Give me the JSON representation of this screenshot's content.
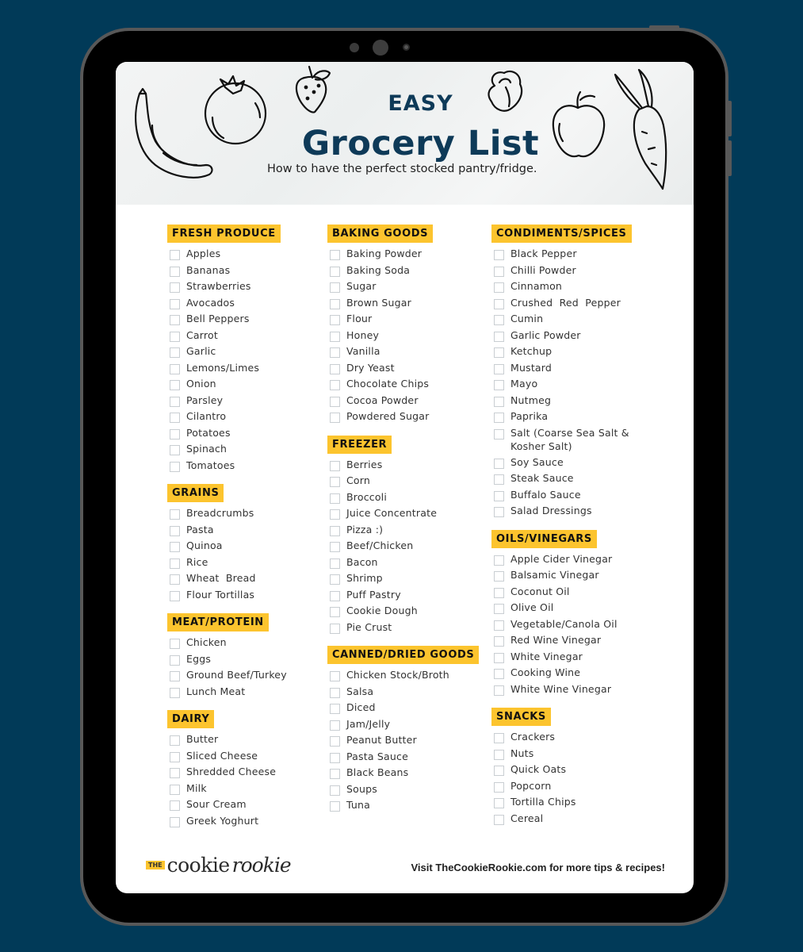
{
  "header": {
    "title_small": "EASY",
    "title_main": "Grocery List",
    "subtitle": "How to have the perfect stocked pantry/fridge.",
    "doodles": [
      "banana-icon",
      "tomato-icon",
      "strawberry-icon",
      "pepper-icon",
      "apple-icon",
      "carrot-icon"
    ]
  },
  "colors": {
    "background": "#013a58",
    "title": "#0e3a58",
    "badge": "#fcc42e"
  },
  "columns": [
    {
      "sections": [
        {
          "title": "FRESH PRODUCE",
          "items": [
            "Apples",
            "Bananas",
            "Strawberries",
            "Avocados",
            "Bell Peppers",
            "Carrot",
            "Garlic",
            "Lemons/Limes",
            "Onion",
            "Parsley",
            "Cilantro",
            "Potatoes",
            "Spinach",
            "Tomatoes"
          ]
        },
        {
          "title": "GRAINS",
          "items": [
            "Breadcrumbs",
            "Pasta",
            "Quinoa",
            "Rice",
            "Wheat  Bread",
            "Flour Tortillas"
          ]
        },
        {
          "title": "MEAT/PROTEIN",
          "items": [
            "Chicken",
            "Eggs",
            "Ground Beef/Turkey",
            "Lunch Meat"
          ]
        },
        {
          "title": "DAIRY",
          "items": [
            "Butter",
            "Sliced Cheese",
            "Shredded Cheese",
            "Milk",
            "Sour Cream",
            "Greek Yoghurt"
          ]
        }
      ]
    },
    {
      "sections": [
        {
          "title": "BAKING GOODS",
          "items": [
            "Baking Powder",
            "Baking Soda",
            "Sugar",
            "Brown Sugar",
            "Flour",
            "Honey",
            "Vanilla",
            "Dry Yeast",
            "Chocolate Chips",
            "Cocoa Powder",
            "Powdered Sugar"
          ]
        },
        {
          "title": "FREEZER",
          "items": [
            "Berries",
            "Corn",
            "Broccoli",
            "Juice Concentrate",
            "Pizza :)",
            "Beef/Chicken",
            "Bacon",
            "Shrimp",
            "Puff Pastry",
            "Cookie Dough",
            "Pie Crust"
          ]
        },
        {
          "title": "CANNED/DRIED GOODS",
          "items": [
            "Chicken Stock/Broth",
            "Salsa",
            "Diced",
            "Jam/Jelly",
            "Peanut Butter",
            "Pasta Sauce",
            "Black Beans",
            "Soups",
            "Tuna"
          ]
        }
      ]
    },
    {
      "sections": [
        {
          "title": "CONDIMENTS/SPICES",
          "items": [
            "Black Pepper",
            "Chilli Powder",
            "Cinnamon",
            "Crushed  Red  Pepper",
            "Cumin",
            "Garlic Powder",
            "Ketchup",
            "Mustard",
            "Mayo",
            "Nutmeg",
            "Paprika",
            "Salt (Coarse Sea Salt & Kosher Salt)",
            "Soy Sauce",
            "Steak Sauce",
            "Buffalo Sauce",
            "Salad Dressings"
          ]
        },
        {
          "title": "OILS/VINEGARS",
          "items": [
            "Apple Cider Vinegar",
            "Balsamic Vinegar",
            "Coconut Oil",
            "Olive Oil",
            "Vegetable/Canola Oil",
            "Red Wine Vinegar",
            "White Vinegar",
            "Cooking Wine",
            "White Wine Vinegar"
          ]
        },
        {
          "title": "SNACKS",
          "items": [
            "Crackers",
            "Nuts",
            "Quick Oats",
            "Popcorn",
            "Tortilla Chips",
            "Cereal"
          ]
        }
      ]
    }
  ],
  "footer": {
    "logo_the": "THE",
    "logo_cookie": "cookie",
    "logo_rookie": "rookie",
    "link_text": "Visit TheCookieRookie.com for more tips & recipes!"
  }
}
